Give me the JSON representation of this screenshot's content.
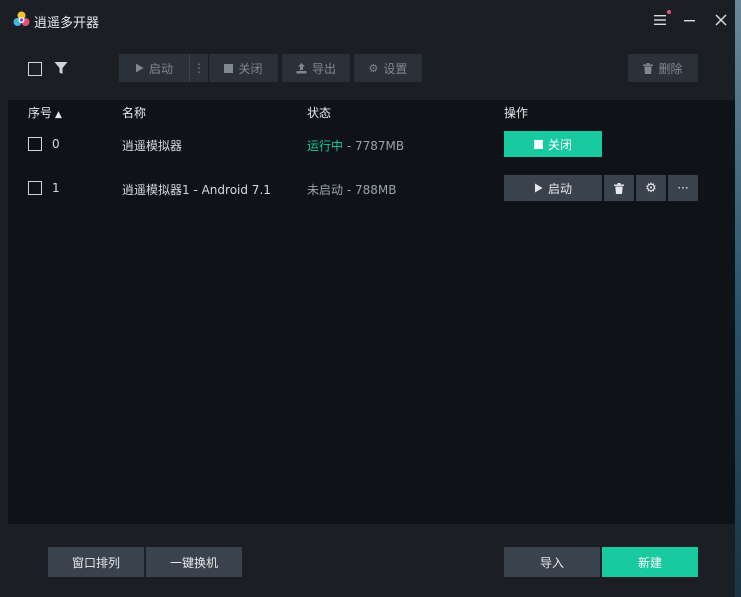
{
  "app": {
    "title": "逍遥多开器"
  },
  "toolbar": {
    "start_label": "启动",
    "more_label": "⋮",
    "close_label": "关闭",
    "export_label": "导出",
    "settings_label": "设置",
    "delete_label": "删除"
  },
  "table": {
    "headers": {
      "index": "序号",
      "sort_indicator": "▲",
      "name": "名称",
      "status": "状态",
      "ops": "操作"
    },
    "rows": [
      {
        "index": "0",
        "name": "逍遥模拟器",
        "status_state": "运行中",
        "status_memory": " - 7787MB",
        "action_label": "关闭"
      },
      {
        "index": "1",
        "name": "逍遥模拟器1 - Android 7.1",
        "status_state": "未启动",
        "status_memory": " - 788MB",
        "action_label": "启动",
        "more_label": "···"
      }
    ]
  },
  "footer": {
    "arrange_label": "窗口排列",
    "switch_label": "一键换机",
    "import_label": "导入",
    "new_label": "新建"
  },
  "icons": {
    "menu": "menu-icon",
    "minimize": "minimize-icon",
    "close": "close-icon",
    "filter": "filter-icon",
    "play": "play-icon",
    "stop": "stop-icon",
    "export": "export-icon",
    "gear": "gear-icon",
    "trash": "trash-icon"
  },
  "colors": {
    "accent": "#19c9a0",
    "window_bg": "#1b1f24",
    "table_bg": "#0f1216",
    "button_bg": "#3a434d",
    "disabled_text": "#7f8790",
    "notify_dot": "#e8507a"
  }
}
